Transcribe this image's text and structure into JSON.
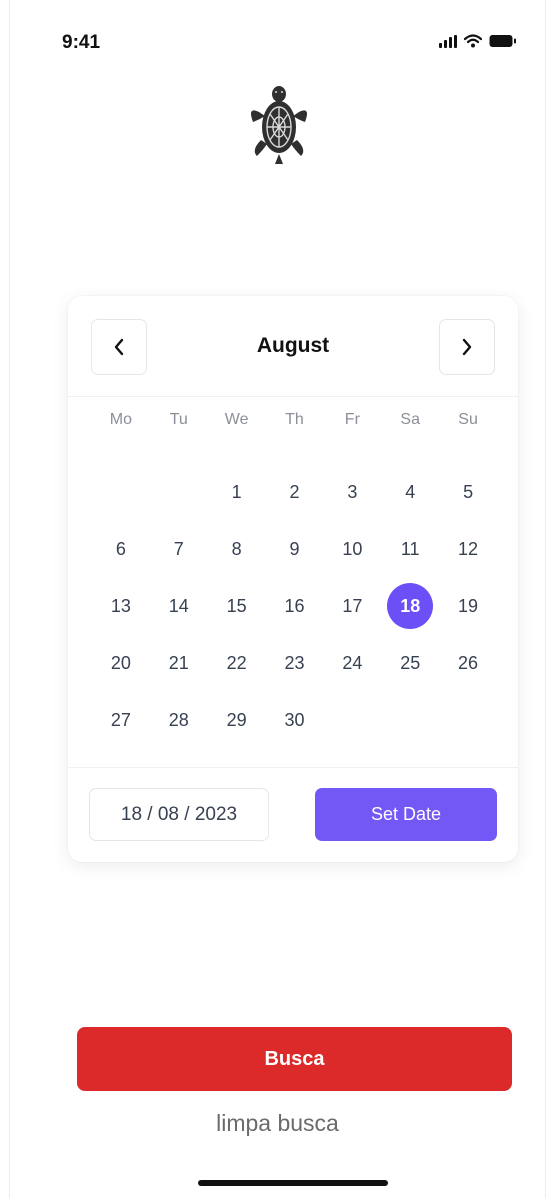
{
  "status_bar": {
    "time": "9:41"
  },
  "icons": {
    "logo": "turtle-logo",
    "signal": "signal-icon",
    "wifi": "wifi-icon",
    "battery": "battery-icon",
    "prev": "chevron-left-icon",
    "next": "chevron-right-icon"
  },
  "calendar": {
    "month": "August",
    "weekdays": [
      "Mo",
      "Tu",
      "We",
      "Th",
      "Fr",
      "Sa",
      "Su"
    ],
    "leading_blanks": 2,
    "days": [
      "1",
      "2",
      "3",
      "4",
      "5",
      "6",
      "7",
      "8",
      "9",
      "10",
      "11",
      "12",
      "13",
      "14",
      "15",
      "16",
      "17",
      "18",
      "19",
      "20",
      "21",
      "22",
      "23",
      "24",
      "25",
      "26",
      "27",
      "28",
      "29",
      "30"
    ],
    "selected_day": "18",
    "date_value": "18 / 08 / 2023",
    "set_date_label": "Set Date"
  },
  "actions": {
    "search_label": "Busca",
    "clear_label": "limpa busca"
  },
  "colors": {
    "accent": "#6c4ff6",
    "button": "#7458f5",
    "danger": "#dc2a2a"
  }
}
